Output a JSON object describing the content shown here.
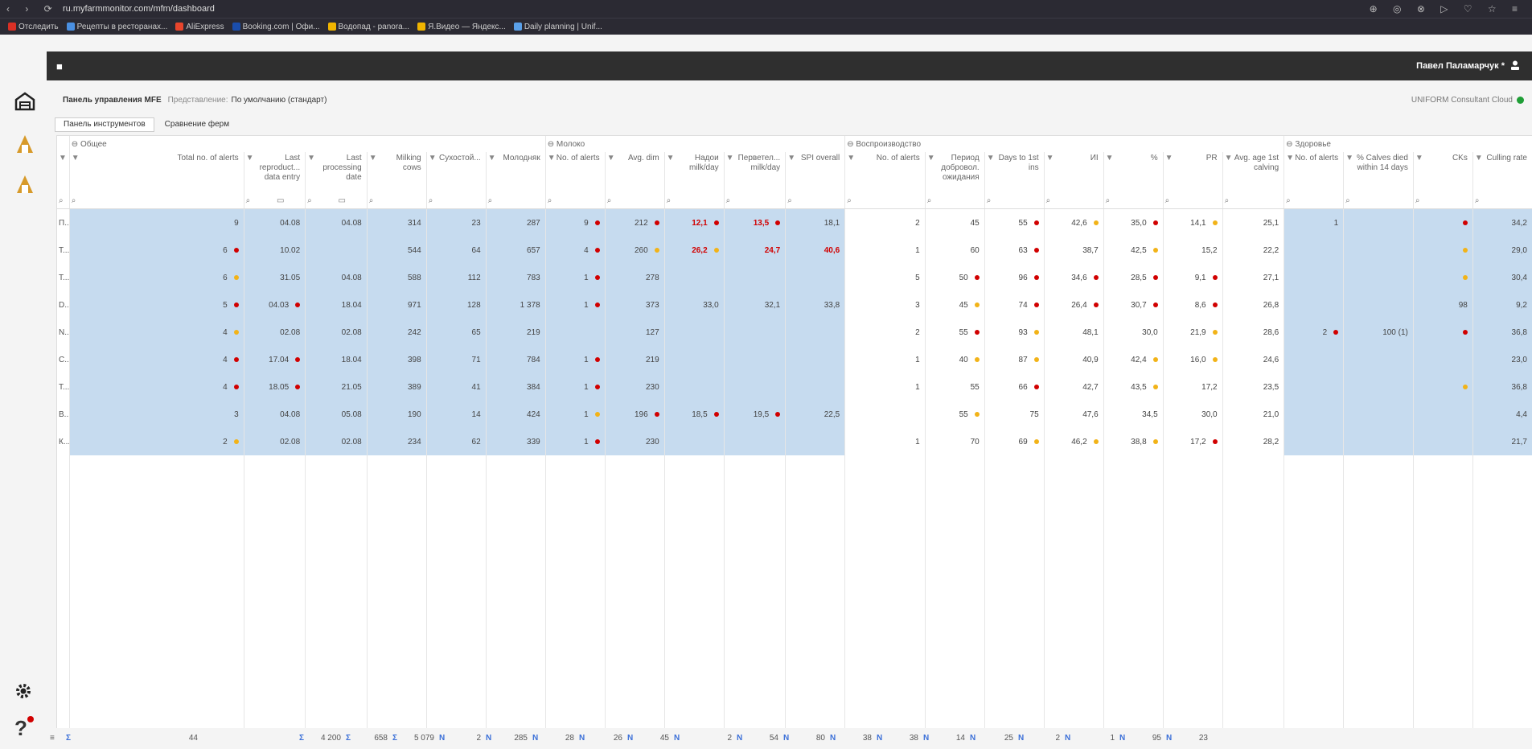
{
  "browser": {
    "nav_icons": "‹ › ⟳",
    "url": "ru.myfarmmonitor.com/mfm/dashboard",
    "toolbar_icons": "⊕ ◎ ⊗ ▷ ♡ ☆ ≡"
  },
  "bookmarks": [
    {
      "label": "Отследить",
      "color": "#d93025"
    },
    {
      "label": "Рецепты в ресторанах...",
      "color": "#4a90e2"
    },
    {
      "label": "AliExpress",
      "color": "#e8452c"
    },
    {
      "label": "Booking.com | Офи...",
      "color": "#1a4dab"
    },
    {
      "label": "Водопад - panora...",
      "color": "#f0b400"
    },
    {
      "label": "Я.Видео — Яндекс...",
      "color": "#f0b400"
    },
    {
      "label": "Daily planning | Unif...",
      "color": "#5aa0e8"
    }
  ],
  "app": {
    "user_name": "Павел Паламарчук *",
    "page_title": "Панель управления MFE",
    "view_label": "Представление:",
    "view_value": "По умолчанию (стандарт)",
    "cloud_status": "UNIFORM Consultant Cloud"
  },
  "tabs": [
    {
      "label": "Панель инструментов",
      "active": true
    },
    {
      "label": "Сравнение ферм",
      "active": false
    }
  ],
  "groups": [
    {
      "label": "Общее",
      "span": 6
    },
    {
      "label": "Молоко",
      "span": 5
    },
    {
      "label": "Воспроизводство",
      "span": 7
    },
    {
      "label": "Здоровье",
      "span": 4
    }
  ],
  "columns": [
    "Total no. of alerts",
    "Last reproduct... data entry",
    "Last processing date",
    "Milking cows",
    "Сухостой...",
    "Молодняк",
    "No. of alerts",
    "Avg. dim",
    "Надои milk/day",
    "Перветел... milk/day",
    "SPI overall",
    "No. of alerts",
    "Период добровол. ожидания",
    "Days to 1st ins",
    "ИІ",
    "%",
    "PR",
    "Avg. age 1st calving",
    "No. of alerts",
    "% Calves died within 14 days",
    "CKs",
    "Culling rate"
  ],
  "rows": [
    {
      "name": "П... V...",
      "cells": [
        {
          "v": "9"
        },
        {
          "v": "04.08"
        },
        {
          "v": "04.08"
        },
        {
          "v": "314"
        },
        {
          "v": "23"
        },
        {
          "v": "287"
        },
        {
          "v": "9",
          "d": "red"
        },
        {
          "v": "212",
          "d": "red"
        },
        {
          "v": "12,1",
          "d": "red",
          "r": true
        },
        {
          "v": "13,5",
          "d": "red",
          "r": true
        },
        {
          "v": "18,1"
        },
        {
          "v": "2"
        },
        {
          "v": "45"
        },
        {
          "v": "55",
          "d": "red"
        },
        {
          "v": "42,6",
          "d": "yellow"
        },
        {
          "v": "35,0",
          "d": "red"
        },
        {
          "v": "14,1",
          "d": "yellow"
        },
        {
          "v": "25,1"
        },
        {
          "v": "1"
        },
        {
          "v": ""
        },
        {
          "v": "",
          "d": "red"
        },
        {
          "v": "34,2"
        }
      ]
    },
    {
      "name": "Т... ... М...",
      "cells": [
        {
          "v": "6",
          "d": "red"
        },
        {
          "v": "10.02"
        },
        {
          "v": ""
        },
        {
          "v": "544"
        },
        {
          "v": "64"
        },
        {
          "v": "657"
        },
        {
          "v": "4",
          "d": "red"
        },
        {
          "v": "260",
          "d": "yellow"
        },
        {
          "v": "26,2",
          "d": "yellow",
          "r": true
        },
        {
          "v": "24,7",
          "r": true
        },
        {
          "v": "40,6",
          "r": true
        },
        {
          "v": "1"
        },
        {
          "v": "60"
        },
        {
          "v": "63",
          "d": "red"
        },
        {
          "v": "38,7"
        },
        {
          "v": "42,5",
          "d": "yellow"
        },
        {
          "v": "15,2"
        },
        {
          "v": "22,2"
        },
        {
          "v": ""
        },
        {
          "v": ""
        },
        {
          "v": "",
          "d": "yellow"
        },
        {
          "v": "29,0"
        }
      ]
    },
    {
      "name": "Т... А... К...",
      "cells": [
        {
          "v": "6",
          "d": "yellow"
        },
        {
          "v": "31.05"
        },
        {
          "v": "04.08"
        },
        {
          "v": "588"
        },
        {
          "v": "112"
        },
        {
          "v": "783"
        },
        {
          "v": "1",
          "d": "red"
        },
        {
          "v": "278"
        },
        {
          "v": ""
        },
        {
          "v": ""
        },
        {
          "v": ""
        },
        {
          "v": "5"
        },
        {
          "v": "50",
          "d": "red"
        },
        {
          "v": "96",
          "d": "red"
        },
        {
          "v": "34,6",
          "d": "red"
        },
        {
          "v": "28,5",
          "d": "red"
        },
        {
          "v": "9,1",
          "d": "red"
        },
        {
          "v": "27,1"
        },
        {
          "v": ""
        },
        {
          "v": ""
        },
        {
          "v": "",
          "d": "yellow"
        },
        {
          "v": "30,4"
        }
      ]
    },
    {
      "name": "D... G...",
      "cells": [
        {
          "v": "5",
          "d": "red"
        },
        {
          "v": "04.03",
          "d": "red"
        },
        {
          "v": "18.04"
        },
        {
          "v": "971"
        },
        {
          "v": "128"
        },
        {
          "v": "1 378"
        },
        {
          "v": "1",
          "d": "red"
        },
        {
          "v": "373"
        },
        {
          "v": "33,0"
        },
        {
          "v": "32,1"
        },
        {
          "v": "33,8"
        },
        {
          "v": "3"
        },
        {
          "v": "45",
          "d": "yellow"
        },
        {
          "v": "74",
          "d": "red"
        },
        {
          "v": "26,4",
          "d": "red"
        },
        {
          "v": "30,7",
          "d": "red"
        },
        {
          "v": "8,6",
          "d": "red"
        },
        {
          "v": "26,8"
        },
        {
          "v": ""
        },
        {
          "v": ""
        },
        {
          "v": "98"
        },
        {
          "v": "9,2"
        }
      ]
    },
    {
      "name": "N... a...",
      "cells": [
        {
          "v": "4",
          "d": "yellow"
        },
        {
          "v": "02.08"
        },
        {
          "v": "02.08"
        },
        {
          "v": "242"
        },
        {
          "v": "65"
        },
        {
          "v": "219"
        },
        {
          "v": ""
        },
        {
          "v": "127"
        },
        {
          "v": ""
        },
        {
          "v": ""
        },
        {
          "v": ""
        },
        {
          "v": "2"
        },
        {
          "v": "55",
          "d": "red"
        },
        {
          "v": "93",
          "d": "yellow"
        },
        {
          "v": "48,1"
        },
        {
          "v": "30,0"
        },
        {
          "v": "21,9",
          "d": "yellow"
        },
        {
          "v": "28,6"
        },
        {
          "v": "2",
          "d": "red"
        },
        {
          "v": "100 (1)"
        },
        {
          "v": "",
          "d": "red"
        },
        {
          "v": "36,8"
        }
      ]
    },
    {
      "name": "С... \"...",
      "cells": [
        {
          "v": "4",
          "d": "red"
        },
        {
          "v": "17.04",
          "d": "red"
        },
        {
          "v": "18.04"
        },
        {
          "v": "398"
        },
        {
          "v": "71"
        },
        {
          "v": "784"
        },
        {
          "v": "1",
          "d": "red"
        },
        {
          "v": "219"
        },
        {
          "v": ""
        },
        {
          "v": ""
        },
        {
          "v": ""
        },
        {
          "v": "1"
        },
        {
          "v": "40",
          "d": "yellow"
        },
        {
          "v": "87",
          "d": "yellow"
        },
        {
          "v": "40,9"
        },
        {
          "v": "42,4",
          "d": "yellow"
        },
        {
          "v": "16,0",
          "d": "yellow"
        },
        {
          "v": "24,6"
        },
        {
          "v": ""
        },
        {
          "v": ""
        },
        {
          "v": ""
        },
        {
          "v": "23,0"
        }
      ]
    },
    {
      "name": "Т... М...",
      "cells": [
        {
          "v": "4",
          "d": "red"
        },
        {
          "v": "18.05",
          "d": "red"
        },
        {
          "v": "21.05"
        },
        {
          "v": "389"
        },
        {
          "v": "41"
        },
        {
          "v": "384"
        },
        {
          "v": "1",
          "d": "red"
        },
        {
          "v": "230"
        },
        {
          "v": ""
        },
        {
          "v": ""
        },
        {
          "v": ""
        },
        {
          "v": "1"
        },
        {
          "v": "55"
        },
        {
          "v": "66",
          "d": "red"
        },
        {
          "v": "42,7"
        },
        {
          "v": "43,5",
          "d": "yellow"
        },
        {
          "v": "17,2"
        },
        {
          "v": "23,5"
        },
        {
          "v": ""
        },
        {
          "v": ""
        },
        {
          "v": "",
          "d": "yellow"
        },
        {
          "v": "36,8"
        }
      ]
    },
    {
      "name": "В... К...",
      "cells": [
        {
          "v": "3"
        },
        {
          "v": "04.08"
        },
        {
          "v": "05.08"
        },
        {
          "v": "190"
        },
        {
          "v": "14"
        },
        {
          "v": "424"
        },
        {
          "v": "1",
          "d": "yellow"
        },
        {
          "v": "196",
          "d": "red"
        },
        {
          "v": "18,5",
          "d": "red"
        },
        {
          "v": "19,5",
          "d": "red"
        },
        {
          "v": "22,5"
        },
        {
          "v": ""
        },
        {
          "v": "55",
          "d": "yellow"
        },
        {
          "v": "75"
        },
        {
          "v": "47,6"
        },
        {
          "v": "34,5"
        },
        {
          "v": "30,0"
        },
        {
          "v": "21,0"
        },
        {
          "v": ""
        },
        {
          "v": ""
        },
        {
          "v": ""
        },
        {
          "v": "4,4"
        }
      ]
    },
    {
      "name": "К...",
      "cells": [
        {
          "v": "2",
          "d": "yellow"
        },
        {
          "v": "02.08"
        },
        {
          "v": "02.08"
        },
        {
          "v": "234"
        },
        {
          "v": "62"
        },
        {
          "v": "339"
        },
        {
          "v": "1",
          "d": "red"
        },
        {
          "v": "230"
        },
        {
          "v": ""
        },
        {
          "v": ""
        },
        {
          "v": ""
        },
        {
          "v": "1"
        },
        {
          "v": "70"
        },
        {
          "v": "69",
          "d": "yellow"
        },
        {
          "v": "46,2",
          "d": "yellow"
        },
        {
          "v": "38,8",
          "d": "yellow"
        },
        {
          "v": "17,2",
          "d": "red"
        },
        {
          "v": "28,2"
        },
        {
          "v": ""
        },
        {
          "v": ""
        },
        {
          "v": ""
        },
        {
          "v": "21,7"
        }
      ]
    }
  ],
  "footer": [
    {
      "type": "Σ",
      "value": "44"
    },
    {
      "type": "",
      "value": ""
    },
    {
      "type": "",
      "value": ""
    },
    {
      "type": "Σ",
      "value": "4 200"
    },
    {
      "type": "Σ",
      "value": "658"
    },
    {
      "type": "Σ",
      "value": "5 079"
    },
    {
      "type": "N",
      "value": "2"
    },
    {
      "type": "N",
      "value": "285"
    },
    {
      "type": "N",
      "value": "28"
    },
    {
      "type": "N",
      "value": "26"
    },
    {
      "type": "N",
      "value": "45"
    },
    {
      "type": "N",
      "value": "2"
    },
    {
      "type": "N",
      "value": "54"
    },
    {
      "type": "N",
      "value": "80"
    },
    {
      "type": "N",
      "value": "38"
    },
    {
      "type": "N",
      "value": "38"
    },
    {
      "type": "N",
      "value": "14"
    },
    {
      "type": "N",
      "value": "25"
    },
    {
      "type": "N",
      "value": "2"
    },
    {
      "type": "N",
      "value": "1"
    },
    {
      "type": "N",
      "value": "95"
    },
    {
      "type": "N",
      "value": "23"
    }
  ],
  "colors": {
    "highlight": "#c6dbef",
    "alert_red": "#d10000",
    "alert_yellow": "#f2b318",
    "online_green": "#1f9e36"
  }
}
